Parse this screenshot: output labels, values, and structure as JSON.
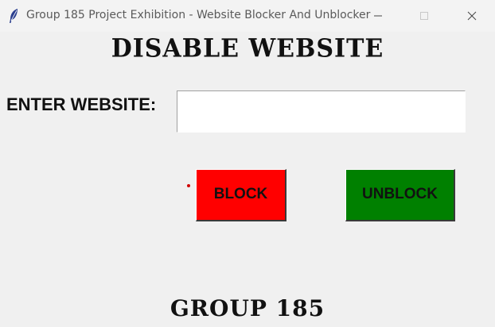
{
  "window": {
    "title": "Group 185 Project Exhibition - Website Blocker And Unblocker",
    "icon": "feather-icon",
    "controls": [
      "minimize-icon",
      "maximize-icon",
      "close-icon"
    ]
  },
  "main": {
    "heading": "DISABLE WEBSITE",
    "website_label": "ENTER WEBSITE:",
    "website_value": "",
    "block_label": "BLOCK",
    "unblock_label": "UNBLOCK",
    "footer": "GROUP 185"
  },
  "colors": {
    "block_button": "#ff0000",
    "unblock_button": "#008000",
    "background": "#f0f0f0"
  }
}
